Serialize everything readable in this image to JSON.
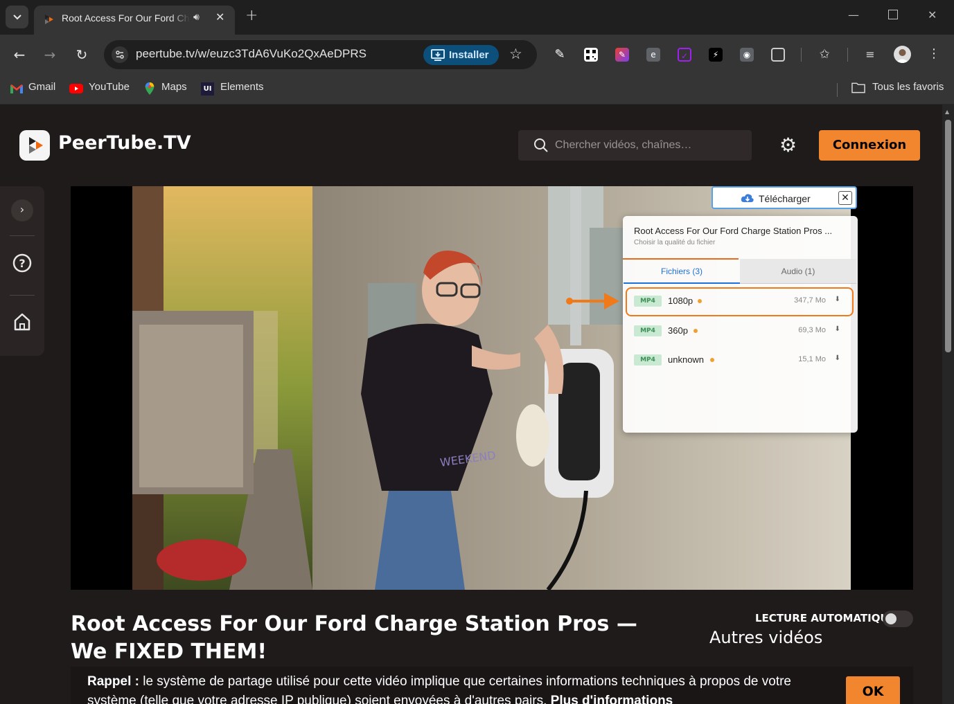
{
  "browser": {
    "tab_title": "Root Access For Our Ford Charge Station Pros — We FIXED THEM!",
    "url": "peertube.tv/w/euzc3TdA6VuKo2QxAeDPRS",
    "install_label": "Installer",
    "bookmarks": [
      "Gmail",
      "YouTube",
      "Maps",
      "Elements"
    ],
    "all_bookmarks": "Tous les favoris"
  },
  "site": {
    "brand": "PeerTube.TV",
    "search_placeholder": "Chercher vidéos, chaînes…",
    "login": "Connexion"
  },
  "download": {
    "button": "Télécharger",
    "title": "Root Access For Our Ford Charge Station Pros ...",
    "subtitle": "Choisir la qualité du fichier",
    "tabs": [
      "Fichiers (3)",
      "Audio (1)"
    ],
    "files": [
      {
        "format": "MP4",
        "quality": "1080p",
        "size": "347,7 Mo"
      },
      {
        "format": "MP4",
        "quality": "360p",
        "size": "69,3 Mo"
      },
      {
        "format": "MP4",
        "quality": "unknown",
        "size": "15,1 Mo"
      }
    ]
  },
  "video": {
    "title": "Root Access For Our Ford Charge Station Pros — We FIXED THEM!",
    "autoplay_label": "LECTURE AUTOMATIQUE",
    "other_videos": "Autres vidéos"
  },
  "notice": {
    "bold": "Rappel :",
    "text": "le système de partage utilisé pour cette vidéo implique que certaines informations techniques à propos de votre système (telle que votre adresse IP publique) soient envoyées à d'autres pairs.",
    "link": "Plus d'informations",
    "ok": "OK"
  },
  "colors": {
    "accent": "#f2862e",
    "page_bg": "#1f1b1a",
    "highlight": "#f07a1a"
  }
}
